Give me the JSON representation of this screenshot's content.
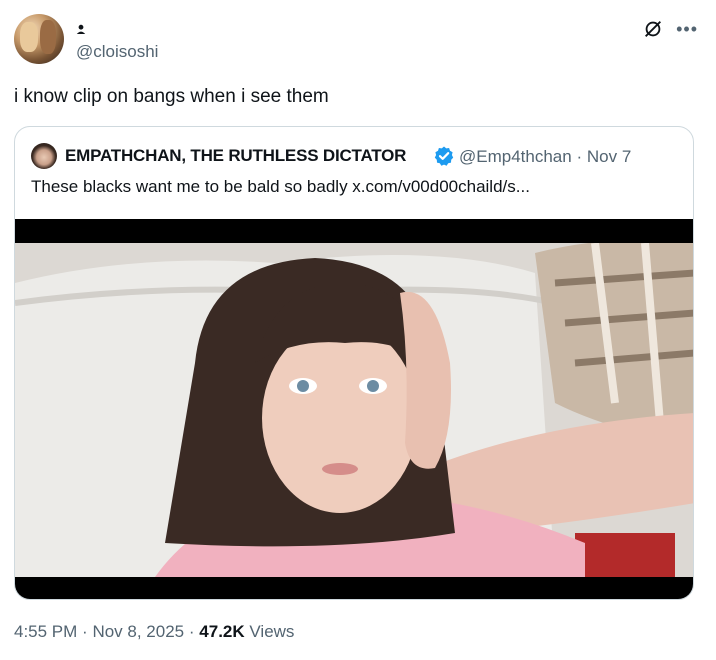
{
  "author": {
    "handle": "@cloisoshi"
  },
  "tweet": {
    "text": "i know clip on bangs when i see them"
  },
  "quote": {
    "name": "EMPATHCHAN, THE RUTHLESS DICTATOR",
    "handle": "@Emp4thchan",
    "separator": "·",
    "date": "Nov 7",
    "text": "These blacks want me to be bald so badly  x.com/v00d00chaild/s..."
  },
  "footer": {
    "time": "4:55 PM",
    "separator": "·",
    "date": "Nov 8, 2025",
    "views_count": "47.2K",
    "views_label": "Views"
  },
  "icons": {
    "grok": "grok-icon",
    "more": "more-icon",
    "verified": "verified-badge-icon",
    "verified_color": "#1d9bf0"
  }
}
